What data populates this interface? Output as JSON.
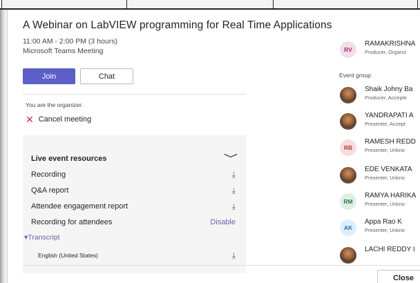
{
  "dialog": {
    "title": "A Webinar on LabVIEW programming for Real Time Applications",
    "time": "11:00 AM - 2:00 PM (3 hours)",
    "location": "Microsoft Teams Meeting",
    "join_label": "Join",
    "chat_label": "Chat",
    "organizer_note": "You are the organizer.",
    "cancel_label": "Cancel meeting",
    "close_label": "Close"
  },
  "resources": {
    "header": "Live event resources",
    "items": [
      {
        "label": "Recording",
        "action": "download"
      },
      {
        "label": "Q&A report",
        "action": "download"
      },
      {
        "label": "Attendee engagement report",
        "action": "download"
      },
      {
        "label": "Recording for attendees",
        "action": "Disable"
      }
    ],
    "transcript_label": "Transcript",
    "transcript_lang": "English (United States)"
  },
  "people": {
    "producer": {
      "initials": "RV",
      "name": "RAMAKRISHNA",
      "role": "Producer, Organiz",
      "color": "#f3dde6",
      "text_color": "#a4326c"
    },
    "event_group_label": "Event group",
    "members": [
      {
        "initials": "",
        "name": "Shaik Johny Ba",
        "role": "Producer, Accepte",
        "photo": true
      },
      {
        "initials": "",
        "name": "YANDRAPATI A",
        "role": "Presenter, Accept",
        "photo": true
      },
      {
        "initials": "RB",
        "name": "RAMESH REDD",
        "role": "Presenter, Unkno",
        "color": "#f7dede",
        "text_color": "#b43a3a"
      },
      {
        "initials": "",
        "name": "EDE VENKATA",
        "role": "Presenter, Unkno",
        "photo": true
      },
      {
        "initials": "RM",
        "name": "RAMYA HARIKA",
        "role": "Presenter, Unkno",
        "color": "#ddf0e3",
        "text_color": "#2f7a4a"
      },
      {
        "initials": "AK",
        "name": "Appa Rao K",
        "role": "Presenter, Unkno",
        "color": "#dcefff",
        "text_color": "#2f6ba8"
      },
      {
        "initials": "",
        "name": "LACHI REDDY I",
        "role": "",
        "photo": true
      }
    ]
  },
  "colors": {
    "accent": "#5b5fc7",
    "link": "#6264a7",
    "danger": "#c4314b"
  }
}
